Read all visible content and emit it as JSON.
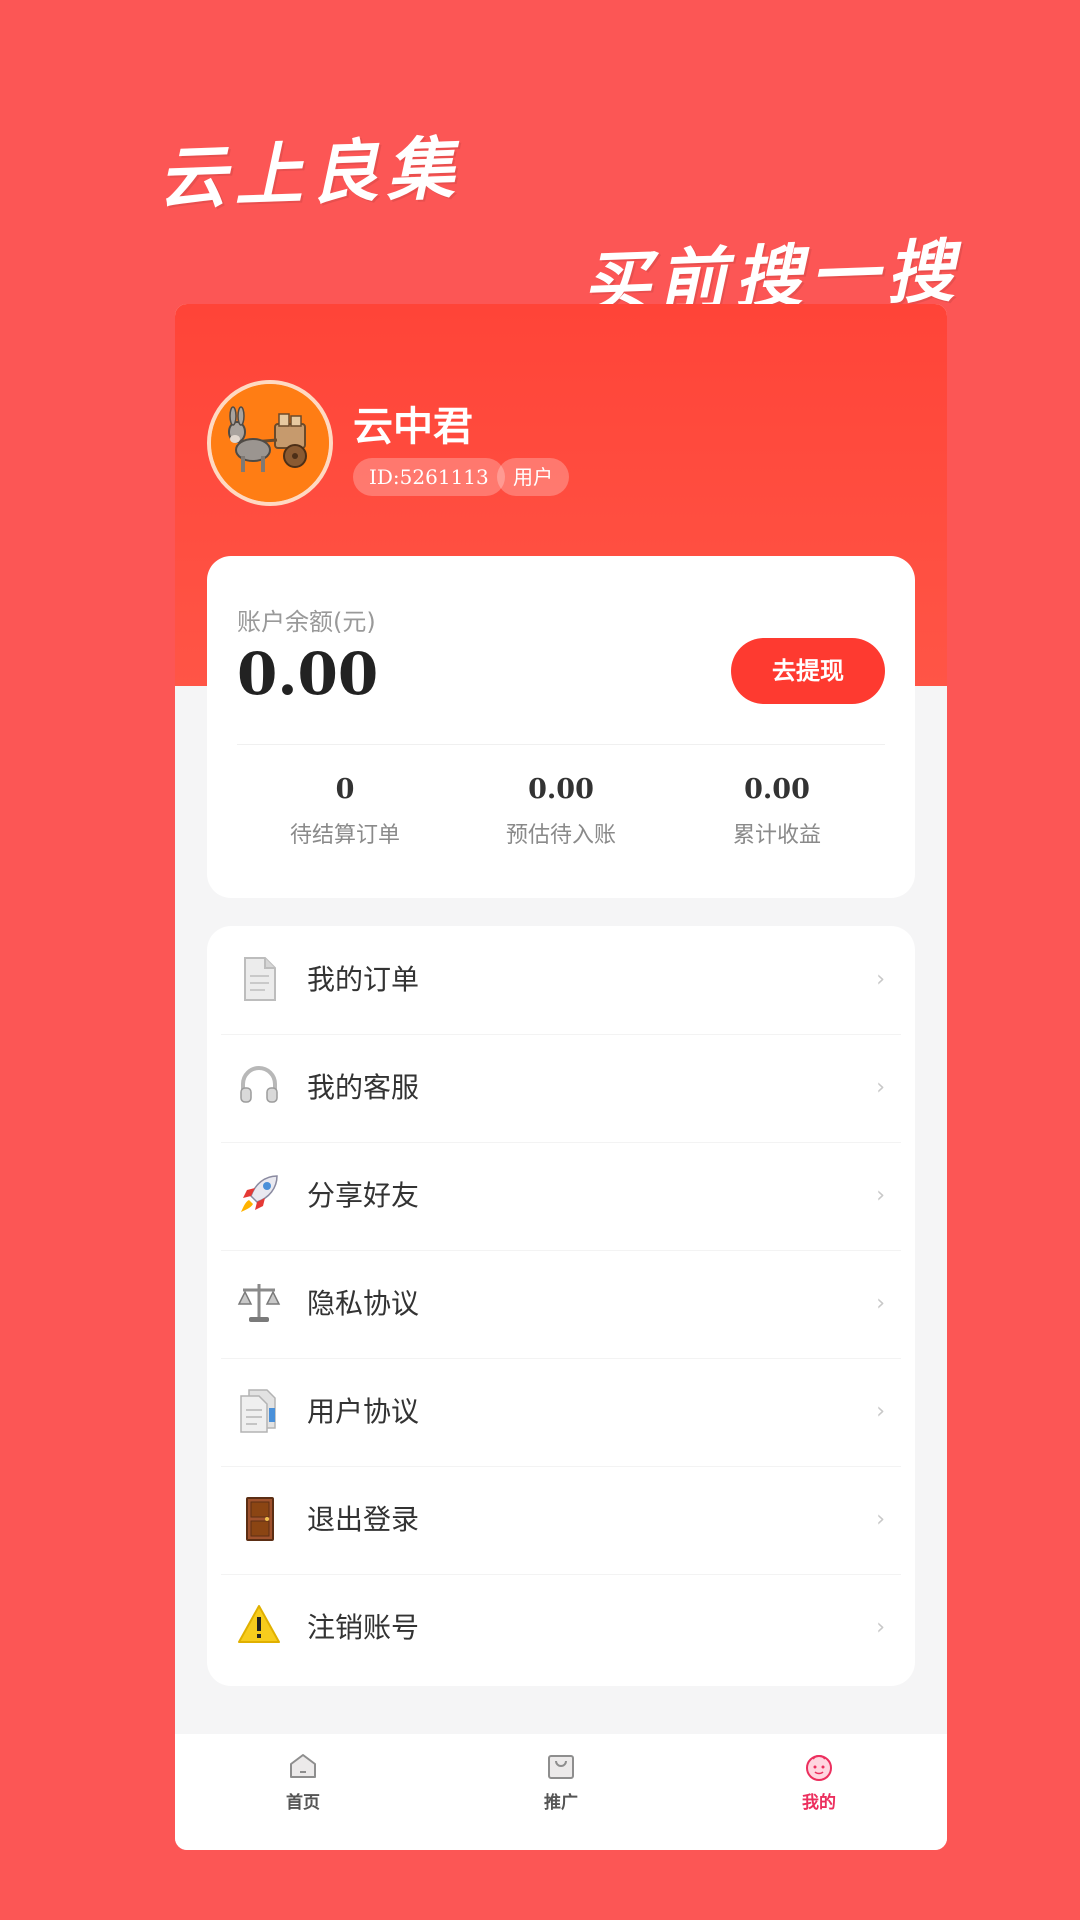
{
  "slogans": {
    "line1": "云上良集",
    "line2": "买前搜一搜"
  },
  "profile": {
    "name": "云中君",
    "id": "ID:5261113",
    "role": "用户"
  },
  "balance": {
    "label": "账户余额(元)",
    "amount": "0.00",
    "withdraw_label": "去提现",
    "stats": [
      {
        "value": "0",
        "label": "待结算订单"
      },
      {
        "value": "0.00",
        "label": "预估待入账"
      },
      {
        "value": "0.00",
        "label": "累计收益"
      }
    ]
  },
  "menu": [
    {
      "label": "我的订单",
      "icon": "document-icon"
    },
    {
      "label": "我的客服",
      "icon": "headphones-icon"
    },
    {
      "label": "分享好友",
      "icon": "rocket-icon"
    },
    {
      "label": "隐私协议",
      "icon": "scales-icon"
    },
    {
      "label": "用户协议",
      "icon": "documents-icon"
    },
    {
      "label": "退出登录",
      "icon": "door-icon"
    },
    {
      "label": "注销账号",
      "icon": "warning-icon"
    }
  ],
  "tabs": [
    {
      "label": "首页",
      "icon": "home-icon",
      "active": false
    },
    {
      "label": "推广",
      "icon": "shopping-bag-icon",
      "active": false
    },
    {
      "label": "我的",
      "icon": "face-icon",
      "active": true
    }
  ],
  "colors": {
    "background": "#fc5655",
    "header": "#ff4438",
    "button": "#fe3a30",
    "active_tab": "#ec2f5e"
  }
}
